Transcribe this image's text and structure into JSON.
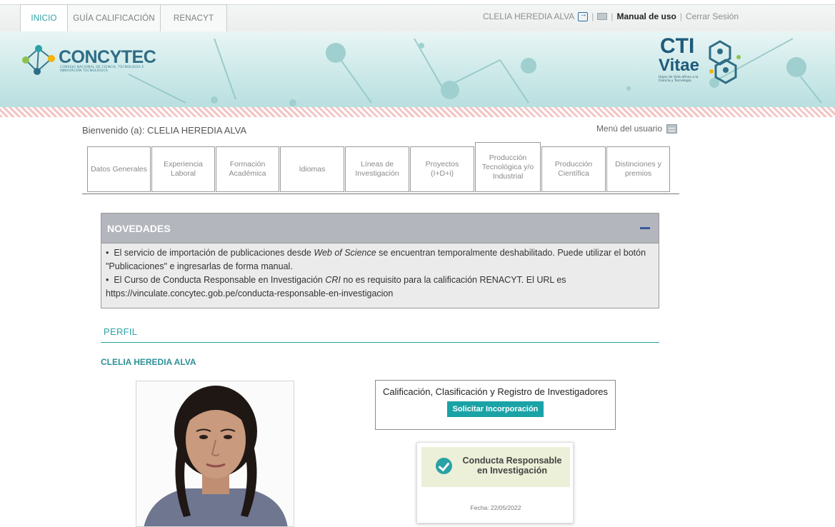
{
  "topnav": {
    "tabs": [
      {
        "label": "INICIO"
      },
      {
        "label": "GUÍA CALIFICACIÓN"
      },
      {
        "label": "RENACYT"
      }
    ],
    "user_name": "CLELIA HEREDIA ALVA",
    "manual": "Manual de uso",
    "logout": "Cerrar Sesión"
  },
  "banner": {
    "logo_name": "CONCYTEC",
    "logo_subtitle": "CONSEJO NACIONAL DE CIENCIA, TECNOLOGÍA E INNOVACIÓN TECNOLÓGICA",
    "cti_top": "CTI",
    "cti_bottom": "Vitae",
    "cti_subtitle": "Hojas de Vida afines a la Ciencia y Tecnología"
  },
  "welcome": {
    "text": "Bienvenido (a): CLELIA HEREDIA ALVA",
    "user_menu": "Menú del usuario"
  },
  "sections": [
    {
      "label": "Datos Generales"
    },
    {
      "label": "Experiencia Laboral"
    },
    {
      "label": "Formación Académica"
    },
    {
      "label": "Idiomas"
    },
    {
      "label": "Líneas de Investigación"
    },
    {
      "label": "Proyectos (I+D+i)"
    },
    {
      "label": "Producción Tecnológica y/o Industrial"
    },
    {
      "label": "Producción Científica"
    },
    {
      "label": "Distinciones y premios"
    }
  ],
  "novedades": {
    "title": "NOVEDADES",
    "item1_pre": "El servicio de importación de publicaciones desde ",
    "item1_em": "Web of Science",
    "item1_post": " se encuentran temporalmente deshabilitado. Puede utilizar el botón \"Publicaciones\" e ingresarlas de forma manual.",
    "item2_pre": "El Curso de Conducta Responsable en Investigación ",
    "item2_em": "CRI",
    "item2_post": " no es requisito para la calificación RENACYT. El URL es https://vinculate.concytec.gob.pe/conducta-responsable-en-investigacion"
  },
  "perfil": {
    "title": "PERFIL",
    "name": "CLELIA HEREDIA ALVA"
  },
  "calificacion": {
    "title": "Calificación, Clasificación y Registro de Investigadores",
    "button": "Solicitar Incorporación"
  },
  "certificado": {
    "title": "Conducta Responsable en Investigación",
    "date": "Fecha: 22/05/2022"
  },
  "colors": {
    "accent": "#2aa2a6",
    "novedades_header": "#b3b6bd",
    "button": "#1aa3a6"
  }
}
